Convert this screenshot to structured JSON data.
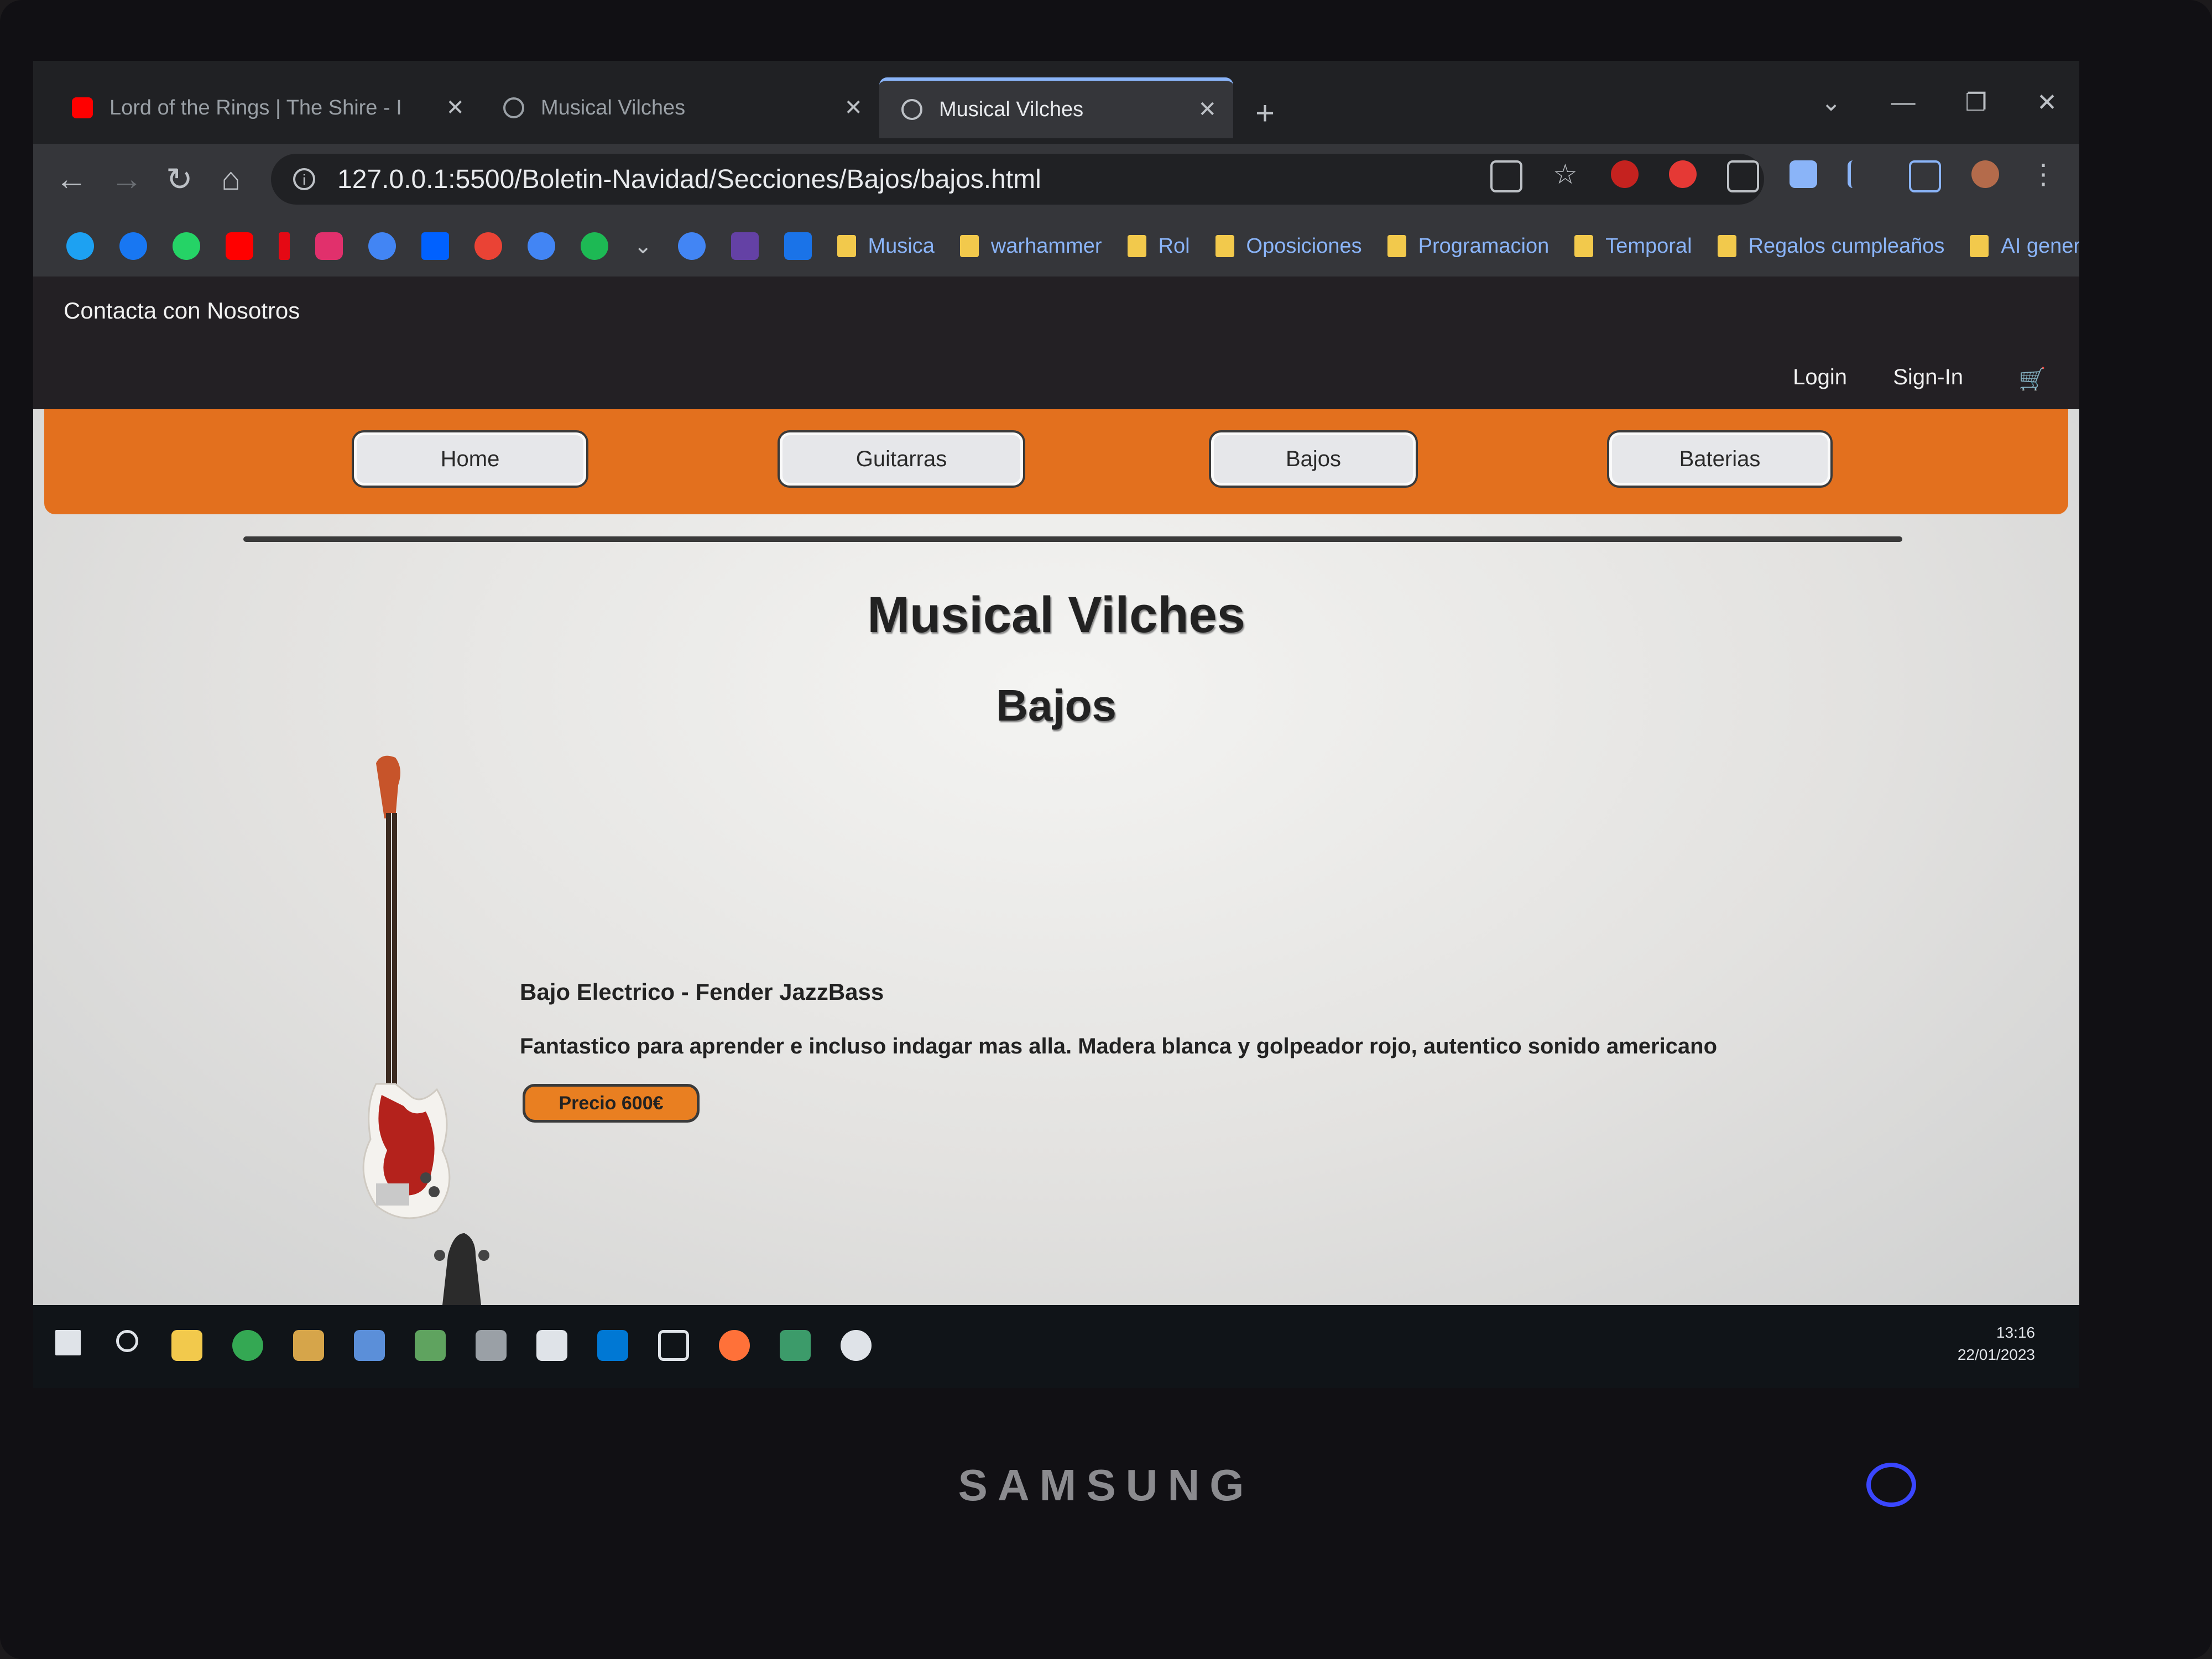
{
  "browser": {
    "tabs": [
      {
        "title": "Lord of the Rings | The Shire - I",
        "icon": "youtube-icon"
      },
      {
        "title": "Musical Vilches",
        "icon": "globe-icon"
      },
      {
        "title": "Musical Vilches",
        "icon": "globe-icon",
        "active": true
      }
    ],
    "new_tab": "+",
    "url": "127.0.0.1:5500/Boletin-Navidad/Secciones/Bajos/bajos.html",
    "bookmark_folders": [
      "Musica",
      "warhammer",
      "Rol",
      "Oposiciones",
      "Programacion",
      "Temporal",
      "Regalos cumpleaños",
      "AI generators"
    ]
  },
  "site": {
    "contact": "Contacta con Nosotros",
    "login": "Login",
    "signin": "Sign-In",
    "nav": [
      "Home",
      "Guitarras",
      "Bajos",
      "Baterias"
    ],
    "title": "Musical Vilches",
    "section": "Bajos"
  },
  "product": {
    "name": "Bajo Electrico - Fender JazzBass",
    "description": "Fantastico para aprender e incluso indagar mas alla. Madera blanca y golpeador rojo, autentico sonido americano",
    "price": "Precio 600€"
  },
  "taskbar": {
    "time": "13:16",
    "date": "22/01/2023"
  },
  "monitor_brand": "SAMSUNG",
  "colors": {
    "nav_orange": "#e3701e",
    "price_orange": "#e97f21",
    "dark_bar": "#232024",
    "link_blue": "#8ab4f8"
  }
}
